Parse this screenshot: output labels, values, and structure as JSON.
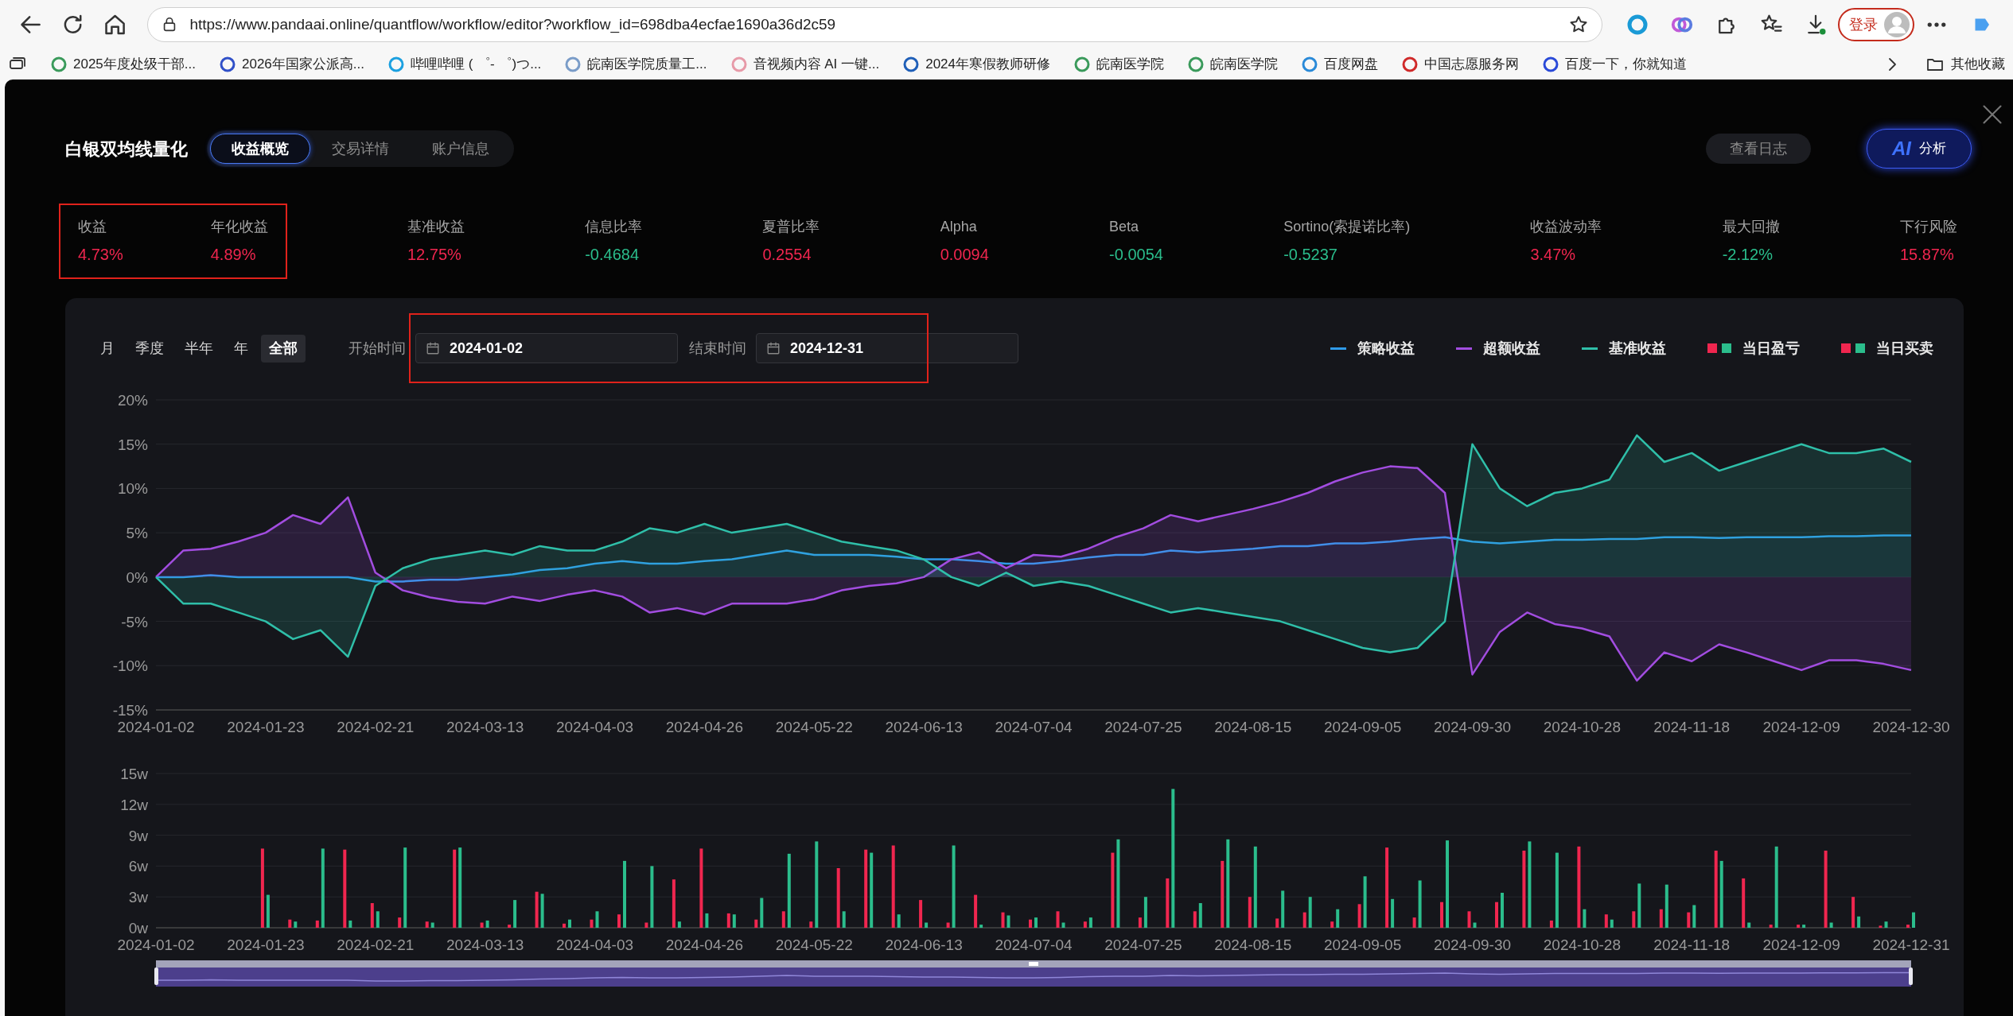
{
  "browser": {
    "url": "https://www.pandaai.online/quantflow/workflow/editor?workflow_id=698dba4ecfae1690a36d2c59",
    "login_label": "登录",
    "bookmarks": [
      {
        "label": "2025年度处级干部..."
      },
      {
        "label": "2026年国家公派高..."
      },
      {
        "label": "哔哩哔哩 ( ゜- ゜)つ..."
      },
      {
        "label": "皖南医学院质量工..."
      },
      {
        "label": "音视频内容 AI 一键..."
      },
      {
        "label": "2024年寒假教师研修"
      },
      {
        "label": "皖南医学院"
      },
      {
        "label": "皖南医学院"
      },
      {
        "label": "百度网盘"
      },
      {
        "label": "中国志愿服务网"
      },
      {
        "label": "百度一下，你就知道"
      }
    ],
    "bookmarks_folder": "其他收藏"
  },
  "dialog": {
    "title": "白银双均线量化",
    "tabs": [
      {
        "label": "收益概览",
        "selected": true
      },
      {
        "label": "交易详情",
        "selected": false
      },
      {
        "label": "账户信息",
        "selected": false
      }
    ],
    "log_button": "查看日志",
    "ai_button": {
      "badge": "AI",
      "label": "分析"
    }
  },
  "metrics": [
    {
      "label": "收益",
      "value": "4.73%",
      "color": "#f0264f",
      "highlighted": true
    },
    {
      "label": "年化收益",
      "value": "4.89%",
      "color": "#f0264f",
      "highlighted": true
    },
    {
      "label": "基准收益",
      "value": "12.75%",
      "color": "#f0264f",
      "highlighted": false
    },
    {
      "label": "信息比率",
      "value": "-0.4684",
      "color": "#2bbd8c",
      "highlighted": false
    },
    {
      "label": "夏普比率",
      "value": "0.2554",
      "color": "#f0264f",
      "highlighted": false
    },
    {
      "label": "Alpha",
      "value": "0.0094",
      "color": "#f0264f",
      "highlighted": false
    },
    {
      "label": "Beta",
      "value": "-0.0054",
      "color": "#2bbd8c",
      "highlighted": false
    },
    {
      "label": "Sortino(索提诺比率)",
      "value": "-0.5237",
      "color": "#2bbd8c",
      "highlighted": false
    },
    {
      "label": "收益波动率",
      "value": "3.47%",
      "color": "#f0264f",
      "highlighted": false
    },
    {
      "label": "最大回撤",
      "value": "-2.12%",
      "color": "#2bbd8c",
      "highlighted": false
    },
    {
      "label": "下行风险",
      "value": "15.87%",
      "color": "#f0264f",
      "highlighted": false
    }
  ],
  "panel": {
    "periods": [
      {
        "label": "月",
        "selected": false
      },
      {
        "label": "季度",
        "selected": false
      },
      {
        "label": "半年",
        "selected": false
      },
      {
        "label": "年",
        "selected": false
      },
      {
        "label": "全部",
        "selected": true
      }
    ],
    "start": {
      "label": "开始时间",
      "value": "2024-01-02"
    },
    "end": {
      "label": "结束时间",
      "value": "2024-12-31"
    },
    "dates_highlighted": true,
    "legend_extra": [
      {
        "label": "当日盈亏",
        "swatches": [
          {
            "color": "#f0264f"
          },
          {
            "color": "#2bbd8c"
          }
        ]
      },
      {
        "label": "当日买卖",
        "swatches": [
          {
            "color": "#f0264f"
          },
          {
            "color": "#2bbd8c"
          }
        ]
      }
    ],
    "return_chart": {
      "chart_data": {
        "type": "area",
        "grid": true,
        "categories": [
          "2024-01-02",
          null,
          null,
          null,
          "2024-01-23",
          null,
          null,
          null,
          "2024-02-21",
          null,
          null,
          null,
          "2024-03-13",
          null,
          null,
          null,
          "2024-04-03",
          null,
          null,
          null,
          "2024-04-26",
          null,
          null,
          null,
          "2024-05-22",
          null,
          null,
          null,
          "2024-06-13",
          null,
          null,
          null,
          "2024-07-04",
          null,
          null,
          null,
          "2024-07-25",
          null,
          null,
          null,
          "2024-08-15",
          null,
          null,
          null,
          "2024-09-05",
          null,
          null,
          null,
          "2024-09-30",
          null,
          null,
          null,
          "2024-10-28",
          null,
          null,
          null,
          "2024-11-18",
          null,
          null,
          null,
          "2024-12-09",
          null,
          null,
          null,
          "2024-12-30"
        ],
        "series": [
          {
            "name": "策略收益",
            "color": "#2f9bea",
            "values": [
              0,
              0,
              0.2,
              0,
              0,
              0,
              0,
              0,
              -0.5,
              -0.5,
              -0.3,
              -0.3,
              0,
              0.3,
              0.8,
              1,
              1.5,
              1.8,
              1.5,
              1.5,
              1.8,
              2,
              2.5,
              3,
              2.5,
              2.5,
              2.5,
              2.3,
              2,
              2,
              1.8,
              1.5,
              1.5,
              1.8,
              2.2,
              2.5,
              2.5,
              3,
              2.8,
              3,
              3.2,
              3.5,
              3.5,
              3.8,
              3.8,
              4,
              4.3,
              4.5,
              4,
              3.8,
              4,
              4.2,
              4.2,
              4.3,
              4.3,
              4.5,
              4.5,
              4.4,
              4.5,
              4.5,
              4.5,
              4.6,
              4.6,
              4.7,
              4.7
            ]
          },
          {
            "name": "超额收益",
            "color": "#a24de0",
            "values": [
              0,
              3,
              3.2,
              4,
              5,
              7,
              6,
              9,
              0.5,
              -1.5,
              -2.3,
              -2.8,
              -3,
              -2.2,
              -2.7,
              -2,
              -1.5,
              -2.2,
              -4,
              -3.5,
              -4.2,
              -3,
              -3,
              -3,
              -2.5,
              -1.5,
              -1,
              -0.7,
              0,
              2,
              2.8,
              1,
              2.5,
              2.3,
              3.2,
              4.5,
              5.5,
              7,
              6.3,
              7,
              7.7,
              8.5,
              9.5,
              10.8,
              11.8,
              12.5,
              12.3,
              9.5,
              -11,
              -6.2,
              -4,
              -5.3,
              -5.8,
              -6.7,
              -11.7,
              -8.5,
              -9.5,
              -7.6,
              -8.5,
              -9.5,
              -10.5,
              -9.4,
              -9.4,
              -9.8,
              -10.5
            ]
          },
          {
            "name": "基准收益",
            "color": "#2fbfa9",
            "values": [
              0,
              -3,
              -3,
              -4,
              -5,
              -7,
              -6,
              -9,
              -1,
              1,
              2,
              2.5,
              3,
              2.5,
              3.5,
              3,
              3,
              4,
              5.5,
              5,
              6,
              5,
              5.5,
              6,
              5,
              4,
              3.5,
              3,
              2,
              0,
              -1,
              0.5,
              -1,
              -0.5,
              -1,
              -2,
              -3,
              -4,
              -3.5,
              -4,
              -4.5,
              -5,
              -6,
              -7,
              -8,
              -8.5,
              -8,
              -5,
              15,
              10,
              8,
              9.5,
              10,
              11,
              16,
              13,
              14,
              12,
              13,
              14,
              15,
              14,
              14,
              14.5,
              13
            ]
          }
        ],
        "ylim": [
          -15,
          20
        ],
        "yticks": [
          {
            "value": 20,
            "label": "20%"
          },
          {
            "value": 15,
            "label": "15%"
          },
          {
            "value": 10,
            "label": "10%"
          },
          {
            "value": 5,
            "label": "5%"
          },
          {
            "value": 0,
            "label": "0%"
          },
          {
            "value": -5,
            "label": "-5%"
          },
          {
            "value": -10,
            "label": "-10%"
          },
          {
            "value": -15,
            "label": "-15%"
          }
        ]
      }
    },
    "volume_chart": {
      "chart_data": {
        "type": "bar",
        "grid": true,
        "categories": [
          "2024-01-02",
          null,
          null,
          null,
          "2024-01-23",
          null,
          null,
          null,
          "2024-02-21",
          null,
          null,
          null,
          "2024-03-13",
          null,
          null,
          null,
          "2024-04-03",
          null,
          null,
          null,
          "2024-04-26",
          null,
          null,
          null,
          "2024-05-22",
          null,
          null,
          null,
          "2024-06-13",
          null,
          null,
          null,
          "2024-07-04",
          null,
          null,
          null,
          "2024-07-25",
          null,
          null,
          null,
          "2024-08-15",
          null,
          null,
          null,
          "2024-09-05",
          null,
          null,
          null,
          "2024-09-30",
          null,
          null,
          null,
          "2024-10-28",
          null,
          null,
          null,
          "2024-11-18",
          null,
          null,
          null,
          "2024-12-09",
          null,
          null,
          null,
          "2024-12-31"
        ],
        "series": [
          {
            "color": "#f0264f",
            "values": [
              0,
              0,
              0,
              0,
              7.7,
              0.8,
              0.7,
              7.6,
              2.4,
              1,
              0.6,
              7.6,
              0.5,
              0.3,
              3.5,
              0.4,
              0.8,
              1.3,
              0.5,
              4.7,
              7.7,
              1.4,
              0.8,
              1.6,
              0.6,
              5.8,
              7.6,
              8,
              2.7,
              0.5,
              3.2,
              1.5,
              0.8,
              1.6,
              0.6,
              7.3,
              1,
              4.8,
              1.6,
              6.5,
              3,
              0.9,
              1.5,
              0.6,
              2.3,
              7.8,
              1,
              2.5,
              1.6,
              2.5,
              7.5,
              0.7,
              7.9,
              1.3,
              1.6,
              1.8,
              1.5,
              7.5,
              4.8,
              0.3,
              0.3,
              7.5,
              3,
              0.2,
              0.3
            ]
          },
          {
            "color": "#2bbd8c",
            "values": [
              0,
              0,
              0,
              0,
              3.2,
              0.6,
              7.7,
              0.7,
              1.6,
              7.8,
              0.5,
              7.8,
              0.7,
              2.7,
              3.3,
              0.8,
              1.6,
              6.5,
              6,
              0.6,
              1.4,
              1.3,
              2.9,
              7.2,
              8.4,
              1.6,
              7.3,
              1.3,
              0.5,
              8,
              0.3,
              1.2,
              1,
              0.5,
              1,
              8.6,
              3,
              13.5,
              2.4,
              8.6,
              7.9,
              3.6,
              3,
              1.8,
              5,
              2.8,
              4.6,
              8.5,
              0.5,
              3.4,
              8.4,
              7.3,
              1.8,
              0.8,
              4.3,
              4.2,
              2.2,
              6.5,
              0.5,
              7.9,
              0.3,
              0.5,
              1.1,
              0.6,
              1.5
            ]
          }
        ],
        "ylim": [
          0,
          15
        ],
        "yticks": [
          {
            "value": 15,
            "label": "15w"
          },
          {
            "value": 12,
            "label": "12w"
          },
          {
            "value": 9,
            "label": "9w"
          },
          {
            "value": 6,
            "label": "6w"
          },
          {
            "value": 3,
            "label": "3w"
          },
          {
            "value": 0,
            "label": "0w"
          }
        ]
      }
    }
  }
}
